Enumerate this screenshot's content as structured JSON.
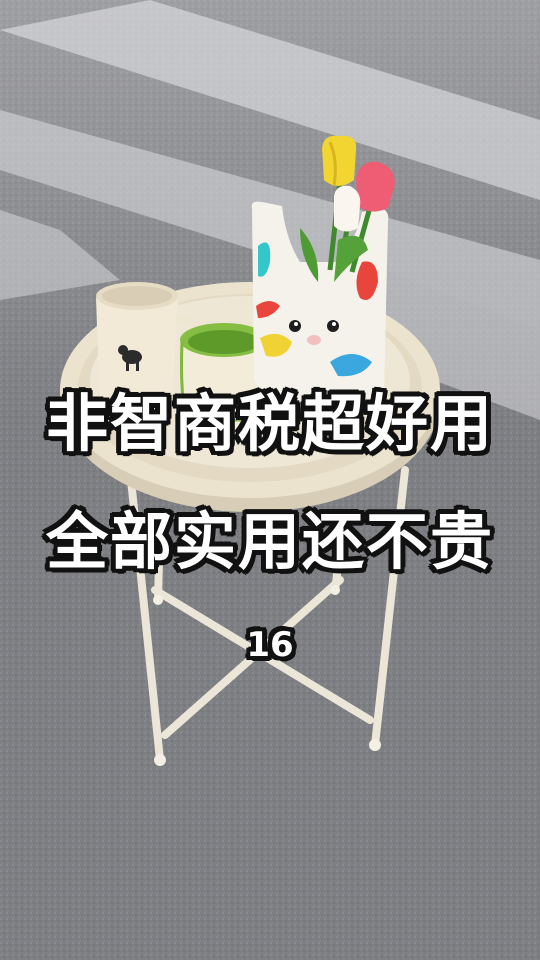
{
  "overlay": {
    "headline": "非智商税超好用",
    "subheadline": "全部实用还不贵",
    "number": "16"
  },
  "colors": {
    "carpet": "#7e7f83",
    "table": "#ece3cf",
    "tulip_yellow": "#f2d531",
    "tulip_pink": "#ef5d74",
    "mug_green": "#7fb83c"
  }
}
